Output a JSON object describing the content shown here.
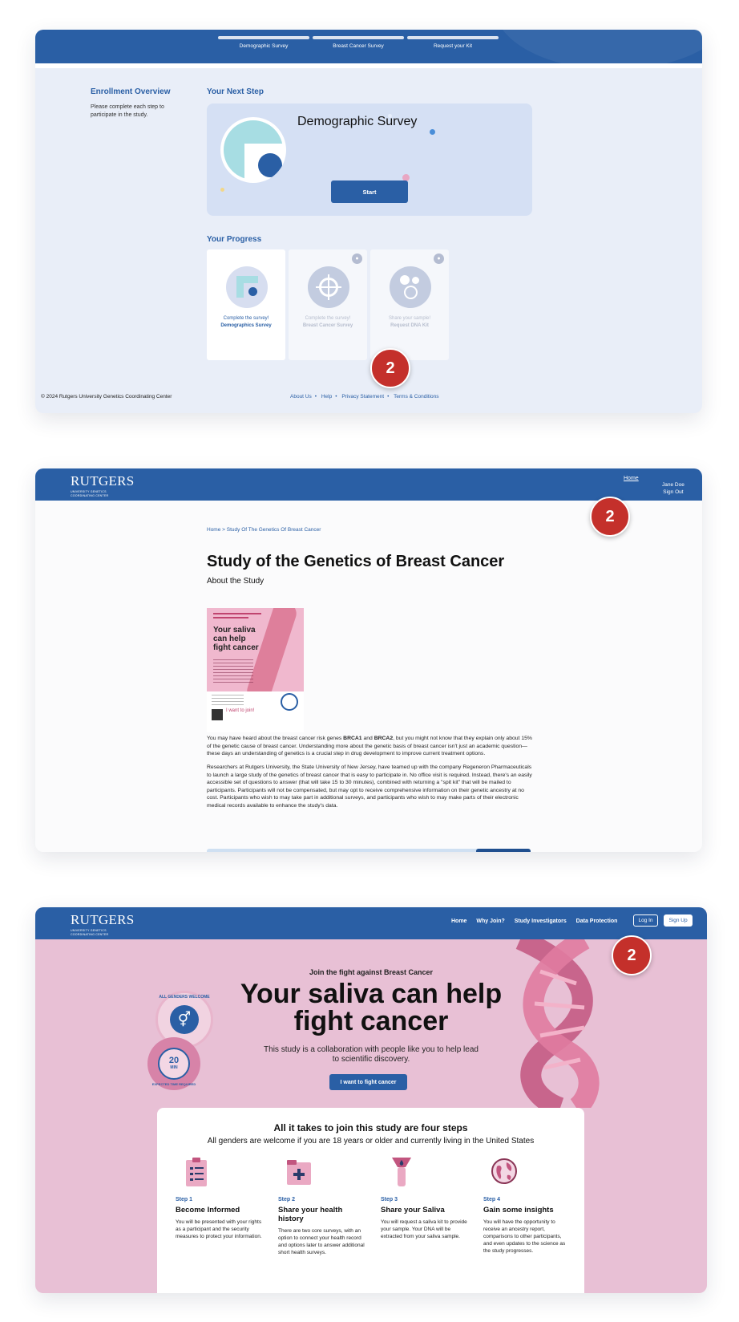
{
  "panel1": {
    "steps": [
      "Demographic Survey",
      "Breast Cancer Survey",
      "Request your Kit"
    ],
    "enrollment_title": "Enrollment Overview",
    "enrollment_desc": "Please complete each step to participate in the study.",
    "next_step_title": "Your Next Step",
    "next_step_name": "Demographic Survey",
    "start_label": "Start",
    "progress_title": "Your Progress",
    "progress_cards": [
      {
        "line1": "Complete the survey!",
        "line2": "Demographics Survey",
        "locked": false
      },
      {
        "line1": "Complete the survey!",
        "line2": "Breast Cancer Survey",
        "locked": true
      },
      {
        "line1": "Share your sample!",
        "line2": "Request DNA Kit",
        "locked": true
      }
    ],
    "copyright": "© 2024 Rutgers University Genetics Coordinating Center",
    "footer_links": [
      "About Us",
      "Help",
      "Privacy Statement",
      "Terms & Conditions"
    ],
    "badge": "2"
  },
  "panel2": {
    "logo": "RUTGERS",
    "logo_sub1": "UNIVERSITY GENETICS",
    "logo_sub2": "COORDINATING CENTER",
    "nav_home": "Home",
    "user_name": "Jane Doe",
    "sign_out": "Sign Out",
    "breadcrumb_home": "Home",
    "breadcrumb_sep": ">",
    "breadcrumb_current": "Study Of The Genetics Of Breast Cancer",
    "title": "Study of the Genetics of Breast Cancer",
    "subtitle": "About the Study",
    "flyer_title": "Your saliva can help fight cancer",
    "flyer_join": "I want to join!",
    "para1_a": "You may have heard about the breast cancer risk genes ",
    "para1_b": "BRCA1",
    "para1_c": " and ",
    "para1_d": "BRCA2",
    "para1_e": ", but you might not know that they explain only about 15% of the genetic cause of breast cancer. Understanding more about the genetic basis of breast cancer isn't just an academic question—these days an understanding of genetics is a crucial step in drug development to improve current treatment options.",
    "para2": "Researchers at Rutgers University, the State University of New Jersey, have teamed up with the company Regeneron Pharmaceuticals to launch a large study of the genetics of breast cancer that is easy to participate in. No office visit is required. Instead, there's an easily accessible set of questions to answer (that will take 15 to 30 minutes), combined with returning a \"spit kit\" that will be mailed to participants. Participants will not be compensated, but may opt to receive comprehensive information on their genetic ancestry at no cost. Participants who wish to may take part in additional surveys, and participants who wish to may make parts of their electronic medical records available to enhance the study's data.",
    "badge": "2"
  },
  "panel3": {
    "logo": "RUTGERS",
    "logo_sub1": "UNIVERSITY GENETICS",
    "logo_sub2": "COORDINATING CENTER",
    "nav": [
      "Home",
      "Why Join?",
      "Study Investigators",
      "Data Protection"
    ],
    "login": "Log In",
    "signup": "Sign Up",
    "eyebrow": "Join the fight against Breast Cancer",
    "hero_line1": "Your saliva can help",
    "hero_line2": "fight cancer",
    "hero_sub": "This study is a collaboration with people like you to help lead to scientific discovery.",
    "cta": "I want to fight cancer",
    "stamp1_text": "ALL GENDERS WELCOME",
    "stamp2_text": "EXPECTED TIME REQUIRED",
    "stamp2_num": "20",
    "stamp2_unit": "MIN",
    "card_title": "All it takes to join this study are four steps",
    "card_sub": "All genders are welcome if you are 18 years or older and currently living in the United States",
    "steps": [
      {
        "num": "Step 1",
        "title": "Become Informed",
        "desc": "You will be presented with your rights as a participant and the security measures to protect your information."
      },
      {
        "num": "Step 2",
        "title": "Share your health history",
        "desc": "There are two core surveys, with an option to connect your health record and options later to answer additional short health surveys."
      },
      {
        "num": "Step 3",
        "title": "Share your Saliva",
        "desc": "You will request a saliva kit to provide your sample. Your DNA will be extracted from your saliva sample."
      },
      {
        "num": "Step 4",
        "title": "Gain some insights",
        "desc": "You will have the opportunity to receive an ancestry report, comparisons to other participants, and even updates to the science as the study progresses."
      }
    ],
    "badge": "2"
  },
  "colors": {
    "brand_blue": "#2a5fa5",
    "badge_red": "#c4302b",
    "pink_bg": "#e8c0d5",
    "light_blue_bg": "#e9eef8"
  }
}
